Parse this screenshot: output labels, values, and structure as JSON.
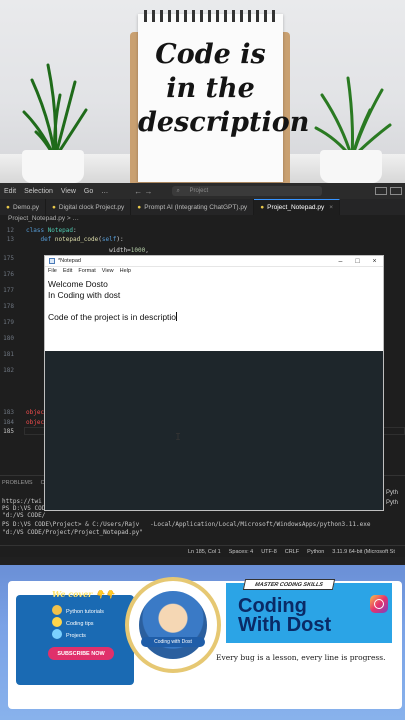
{
  "photo": {
    "note_lines": [
      "Code is",
      "in the",
      "description"
    ]
  },
  "vscode": {
    "menu": [
      "Edit",
      "Selection",
      "View",
      "Go",
      "…"
    ],
    "nav_arrows": "← →",
    "command_placeholder": "Project",
    "tabs": [
      {
        "label": "Demo.py",
        "active": false
      },
      {
        "label": "Digital clock Project.py",
        "active": false
      },
      {
        "label": "Prompt AI (Integrating ChatGPT).py",
        "active": false
      },
      {
        "label": "Project_Notepad.py",
        "active": true
      }
    ],
    "breadcrumb": "Project_Notepad.py > …",
    "code_lines": [
      {
        "num": "12",
        "text": "class Notepad:"
      },
      {
        "num": "13",
        "text": "    def notepad_code(self):"
      },
      {
        "num": "",
        "text": "                           width=1000,"
      },
      {
        "num": "175",
        "text": ""
      },
      {
        "num": "176",
        "text": ""
      },
      {
        "num": "177",
        "text": ""
      },
      {
        "num": "178",
        "text": ""
      },
      {
        "num": "179",
        "text": ""
      },
      {
        "num": "180",
        "text": ""
      },
      {
        "num": "181",
        "text": ""
      },
      {
        "num": "182",
        "text": ""
      },
      {
        "num": "183",
        "text": "object"
      },
      {
        "num": "184",
        "text": "object"
      },
      {
        "num": "185",
        "text": ""
      }
    ],
    "panel_tabs": [
      "PROBLEMS",
      "OU"
    ],
    "terminal_lines": [
      "https://twi",
      "PS D:\\VS COD",
      "\"d:/VS CODE/",
      "PS D:\\VS CODE\\Project> & C:/Users/Rajv   -Local/Application/Local/Microsoft/WindowsApps/python3.11.exe",
      "\"d:/VS CODE/Project/Project_Notepad.py\""
    ],
    "terminal_side": [
      "Pyth",
      "Pyth"
    ],
    "status": {
      "position": "Ln 185, Col 1",
      "spaces": "Spaces: 4",
      "encoding": "UTF-8",
      "eol": "CRLF",
      "language": "Python",
      "interpreter": "3.11.9 64-bit (Microsoft St"
    }
  },
  "notepad": {
    "title": "*Notepad",
    "controls": [
      "–",
      "□",
      "×"
    ],
    "menu": [
      "File",
      "Edit",
      "Format",
      "View",
      "Help"
    ],
    "lines": [
      "Welcome Dosto",
      "In Coding with dost",
      "",
      "Code of the project is in descriptio"
    ]
  },
  "banner": {
    "cover_title": "We cover 👇👇",
    "cover_items": [
      "Python tutorials",
      "Coding tips",
      "Projects"
    ],
    "subscribe": "SUBSCRIBE NOW",
    "avatar_label": "Coding with Dost",
    "skills": "MASTER CODING SKILLS",
    "brand_line1": "Coding",
    "brand_line2": "With Dost",
    "tagline": "Every bug is a lesson, every line is progress.",
    "instagram_icon": "instagram-icon"
  },
  "colors": {
    "vscode_bg": "#1e1e1e",
    "accent_tab": "#3794ff",
    "banner_blue": "#2ba4e6",
    "brand_navy": "#0a2a66",
    "subscribe_pink": "#e0306b"
  }
}
